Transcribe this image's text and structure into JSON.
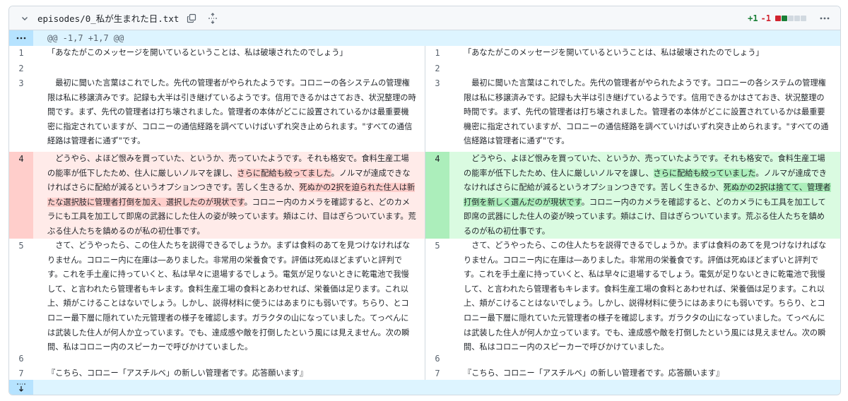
{
  "file": {
    "path": "episodes/0_私が生まれた日.txt",
    "additions": "+1",
    "deletions": "-1",
    "diffstat_colors": [
      "#d1242f",
      "#1a7f37",
      "#d1d9e0",
      "#d1d9e0",
      "#d1d9e0"
    ],
    "icons": {
      "collapse": "chevron-down-icon",
      "copy": "copy-icon",
      "expand": "unfold-icon",
      "more": "kebab-horizontal-icon"
    }
  },
  "hunk": {
    "header": "@@ -1,7 +1,7 @@"
  },
  "colors": {
    "deletion_bg": "#ffebe9",
    "deletion_highlight": "#ffcecb",
    "addition_bg": "#dafbe1",
    "addition_highlight": "#aceebb",
    "hunk_bg": "#ddf4ff"
  },
  "left": {
    "lines": [
      {
        "num": "1",
        "text": "「あなたがこのメッセージを開いているということは、私は破壊されたのでしょう」"
      },
      {
        "num": "2",
        "text": ""
      },
      {
        "num": "3",
        "text": "　最初に聞いた言葉はこれでした。先代の管理者がやられたようです。コロニーの各システムの管理権限は私に移譲済みです。記録も大半は引き継げているようです。信用できるかはさておき、状況整理の時間です。まず、先代の管理者は打ち壊されました。管理者の本体がどこに設置されているかは最重要機密に指定されていますが、コロニーの通信経路を調べていけばいずれ突き止められます。\"すべての通信経路は管理者に通ず\"です。"
      },
      {
        "num": "4",
        "a": "　どうやら、よほど恨みを買っていた、というか、売っていたようです。それも格安で。食料生産工場の能率が低下したため、住人に厳しいノルマを課し、",
        "b": "さらに配給も絞ってました",
        "c": "。ノルマが達成できなければさらに配給が減るというオプションつきです。苦しく生きるか、",
        "d": "死ぬかの2択を迫られた住人は新たな選択肢に管理者打倒を加え、選択したのが現状です",
        "e": "。コロニー内のカメラを確認すると、どのカメラにも工具を加工して即席の武器にした住人の姿が映っています。頬はこけ、目はぎらついています。荒ぶる住人たちを鎮めるのが私の初仕事です。"
      },
      {
        "num": "5",
        "text": "　さて、どうやったら、この住人たちを説得できるでしょうか。まずは食料のあてを見つけなければなりません。コロニー内に在庫は―ありました。非常用の栄養食です。評価は死ぬほどまずいと評判です。これを手土産に持っていくと、私は早々に退場するでしょう。電気が足りないときに乾電池で我慢して、と言われたら管理者もキレます。食料生産工場の食料とあわせれば、栄養価は足ります。これ以上、頬がこけることはないでしょう。しかし、説得材料に使うにはあまりにも弱いです。ちらり、とコロニー最下層に隠れていた元管理者の様子を確認します。ガラクタの山になっていました。てっぺんには武装した住人が何人か立っています。でも、達成感や敵を打倒したという風には見えません。次の瞬間、私はコロニー内のスピーカーで呼びかけていました。"
      },
      {
        "num": "6",
        "text": ""
      },
      {
        "num": "7",
        "text": "『こちら、コロニー「アスチルベ」の新しい管理者です。応答願います』"
      }
    ]
  },
  "right": {
    "lines": [
      {
        "num": "1",
        "text": "「あなたがこのメッセージを開いているということは、私は破壊されたのでしょう」"
      },
      {
        "num": "2",
        "text": ""
      },
      {
        "num": "3",
        "text": "　最初に聞いた言葉はこれでした。先代の管理者がやられたようです。コロニーの各システムの管理権限は私に移譲済みです。記録も大半は引き継げているようです。信用できるかはさておき、状況整理の時間です。まず、先代の管理者は打ち壊されました。管理者の本体がどこに設置されているかは最重要機密に指定されていますが、コロニーの通信経路を調べていけばいずれ突き止められます。\"すべての通信経路は管理者に通ず\"です。"
      },
      {
        "num": "4",
        "a": "　どうやら、よほど恨みを買っていた、というか、売っていたようです。それも格安で。食料生産工場の能率が低下したため、住人に厳しいノルマを課し、",
        "b": "さらに配給も絞っていました",
        "c": "。ノルマが達成できなければさらに配給が減るというオプションつきです。苦しく生きるか、",
        "d": "死ぬかの2択は捨てて、管理者打倒を新しく選んだのが現状です",
        "e": "。コロニー内のカメラを確認すると、どのカメラにも工具を加工して即席の武器にした住人の姿が映っています。頬はこけ、目はぎらついています。荒ぶる住人たちを鎮めるのが私の初仕事です。"
      },
      {
        "num": "5",
        "text": "　さて、どうやったら、この住人たちを説得できるでしょうか。まずは食料のあてを見つけなければなりません。コロニー内に在庫は―ありました。非常用の栄養食です。評価は死ぬほどまずいと評判です。これを手土産に持っていくと、私は早々に退場するでしょう。電気が足りないときに乾電池で我慢して、と言われたら管理者もキレます。食料生産工場の食料とあわせれば、栄養価は足ります。これ以上、頬がこけることはないでしょう。しかし、説得材料に使うにはあまりにも弱いです。ちらり、とコロニー最下層に隠れていた元管理者の様子を確認します。ガラクタの山になっていました。てっぺんには武装した住人が何人か立っています。でも、達成感や敵を打倒したという風には見えません。次の瞬間、私はコロニー内のスピーカーで呼びかけていました。"
      },
      {
        "num": "6",
        "text": ""
      },
      {
        "num": "7",
        "text": "『こちら、コロニー「アスチルベ」の新しい管理者です。応答願います』"
      }
    ]
  }
}
